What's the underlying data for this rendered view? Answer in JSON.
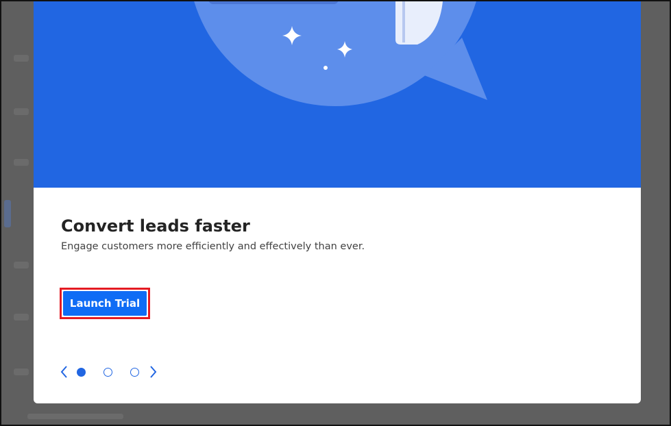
{
  "slide": {
    "title": "Convert leads faster",
    "subtitle": "Engage customers more efficiently and effectively than ever.",
    "cta_label": "Launch Trial"
  },
  "carousel": {
    "total_slides": 3,
    "active_index": 0,
    "prev_icon": "chevron-left-icon",
    "next_icon": "chevron-right-icon"
  },
  "colors": {
    "hero_background": "#2166e2",
    "primary_button": "#0f6cf5",
    "highlight_border": "#e41b23",
    "overlay": "#5f5f5f"
  }
}
